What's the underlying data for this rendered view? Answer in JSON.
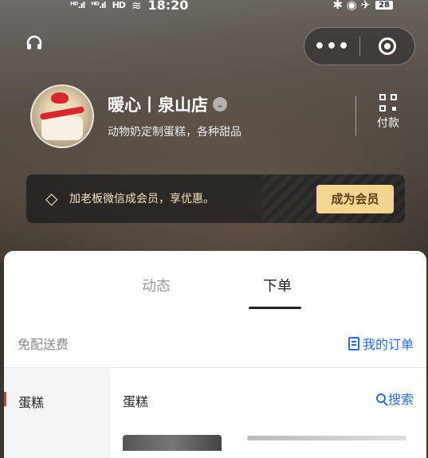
{
  "status_bar": {
    "signal_1": "ᴴᴰ.ıl",
    "signal_2": "ᴴᴰ.ıl",
    "hd": "HD",
    "wifi": "≋",
    "time": "18:20",
    "icons_right": "✱ ◉ ✈",
    "battery": "28"
  },
  "topbar": {
    "support_icon": "headset-icon",
    "more_label": "•••",
    "close_icon": "target-icon"
  },
  "shop": {
    "name": "暖心丨泉山店",
    "verify_glyph": "⌄",
    "description": "动物奶定制蛋糕，各种甜品",
    "pay_label": "付款"
  },
  "member": {
    "icon_glyph": "◇",
    "text": "加老板微信成会员，享优惠。",
    "button_label": "成为会员"
  },
  "tabs": [
    {
      "label": "动态",
      "active": false
    },
    {
      "label": "下单",
      "active": true
    }
  ],
  "order_bar": {
    "free_delivery": "免配送费",
    "my_orders": "我的订单"
  },
  "categories": [
    {
      "label": "蛋糕",
      "active": true
    }
  ],
  "section": {
    "title": "蛋糕",
    "search_label": "搜索"
  },
  "colors": {
    "accent_blue": "#2b6bd9",
    "member_gold": "#f3d58f",
    "active_red": "#e03a3a"
  }
}
